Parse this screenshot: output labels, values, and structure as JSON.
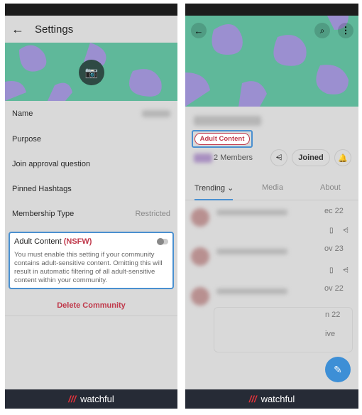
{
  "left": {
    "title": "Settings",
    "rows": [
      {
        "label": "Name",
        "value": ""
      },
      {
        "label": "Purpose",
        "value": ""
      },
      {
        "label": "Join approval question",
        "value": ""
      },
      {
        "label": "Pinned Hashtags",
        "value": ""
      },
      {
        "label": "Membership Type",
        "value": "Restricted"
      }
    ],
    "adult": {
      "label": "Adult Content",
      "tag": "(NSFW)",
      "toggle_on": false,
      "description": "You must enable this setting if your community contains adult-sensitive content. Omitting this will result in automatic filtering of all adult-sensitive content within your community."
    },
    "delete_label": "Delete Community"
  },
  "right": {
    "badge": "Adult Content",
    "members": "2 Members",
    "joined": "Joined",
    "tabs": [
      "Trending",
      "Media",
      "About"
    ],
    "posts": [
      {
        "date": "ec 22"
      },
      {
        "date": "ov 23"
      },
      {
        "date": "ov 22"
      }
    ],
    "quoted": {
      "date": "n 22",
      "snippet": "ive"
    }
  },
  "footer": {
    "brand": "watchful"
  },
  "colors": {
    "accent": "#4a90d0",
    "danger": "#c0394b",
    "banner": "#5fb89a"
  }
}
